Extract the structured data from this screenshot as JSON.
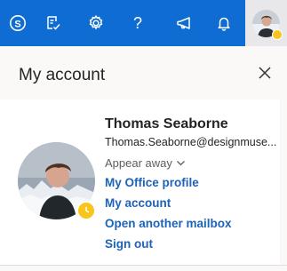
{
  "topbar": {
    "icons": [
      "skype-icon",
      "feedback-icon",
      "gear-icon",
      "help-icon",
      "megaphone-icon",
      "bell-icon"
    ],
    "background": "#0f6cd3"
  },
  "panel": {
    "title": "My account",
    "close_icon": "close-icon"
  },
  "profile": {
    "name": "Thomas Seaborne",
    "email": "Thomas.Seaborne@designmuse...",
    "presence": "Appear away",
    "status_color": "#f8c51c"
  },
  "links": {
    "office_profile": "My Office profile",
    "my_account": "My account",
    "open_mailbox": "Open another mailbox",
    "sign_out": "Sign out"
  }
}
